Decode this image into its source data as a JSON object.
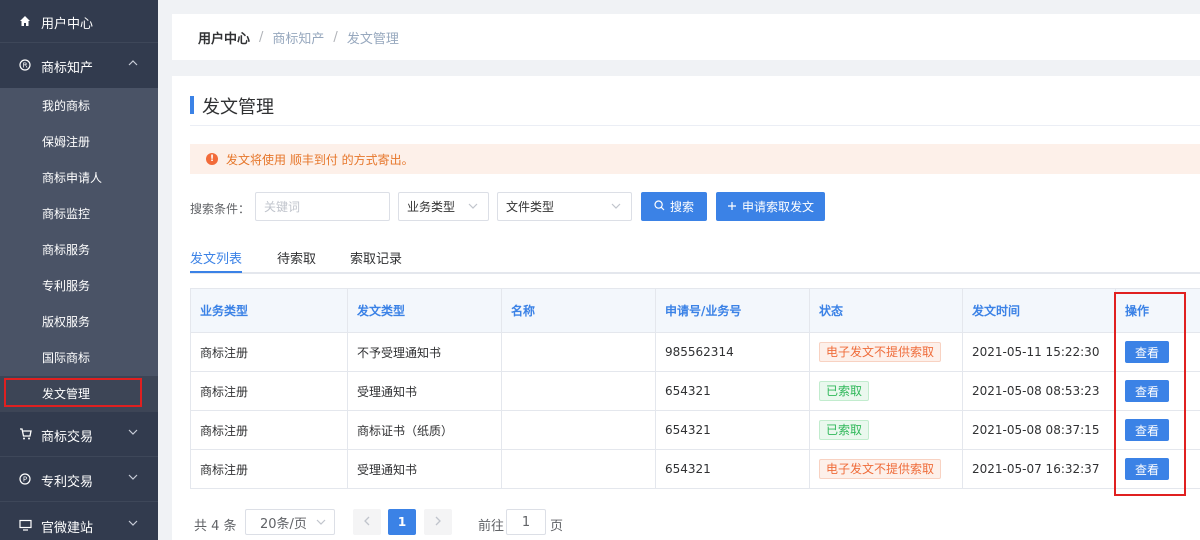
{
  "sidebar": {
    "top_items": [
      {
        "label": "用户中心",
        "icon": "home-icon"
      },
      {
        "label": "商标知产",
        "icon": "registered-icon"
      }
    ],
    "sub_items": [
      "我的商标",
      "保姆注册",
      "商标申请人",
      "商标监控",
      "商标服务",
      "专利服务",
      "版权服务",
      "国际商标",
      "发文管理"
    ],
    "bottom_items": [
      {
        "label": "商标交易",
        "icon": "cart-icon"
      },
      {
        "label": "专利交易",
        "icon": "patent-icon"
      },
      {
        "label": "官微建站",
        "icon": "monitor-icon"
      }
    ]
  },
  "breadcrumb": [
    "用户中心",
    "商标知产",
    "发文管理"
  ],
  "page_title": "发文管理",
  "notice": {
    "text": "发文将使用 顺丰到付 的方式寄出。"
  },
  "search": {
    "label": "搜索条件：",
    "keyword_placeholder": "关键词",
    "business_type": "业务类型",
    "file_type": "文件类型",
    "search_button": "搜索",
    "apply_button": "申请索取发文"
  },
  "tabs": [
    "发文列表",
    "待索取",
    "索取记录"
  ],
  "table": {
    "headers": [
      "业务类型",
      "发文类型",
      "名称",
      "申请号/业务号",
      "状态",
      "发文时间",
      "操作"
    ],
    "rows": [
      {
        "business": "商标注册",
        "doc_type": "不予受理通知书",
        "name": "",
        "number": "985562314",
        "status": "电子发文不提供索取",
        "status_kind": "warn",
        "time": "2021-05-11 15:22:30",
        "action": "查看"
      },
      {
        "business": "商标注册",
        "doc_type": "受理通知书",
        "name": "",
        "number": "654321",
        "status": "已索取",
        "status_kind": "ok",
        "time": "2021-05-08 08:53:23",
        "action": "查看"
      },
      {
        "business": "商标注册",
        "doc_type": "商标证书（纸质）",
        "name": "",
        "number": "654321",
        "status": "已索取",
        "status_kind": "ok",
        "time": "2021-05-08 08:37:15",
        "action": "查看"
      },
      {
        "business": "商标注册",
        "doc_type": "受理通知书",
        "name": "",
        "number": "654321",
        "status": "电子发文不提供索取",
        "status_kind": "warn",
        "time": "2021-05-07 16:32:37",
        "action": "查看"
      }
    ]
  },
  "pagination": {
    "total": "共 4 条",
    "page_size": "20条/页",
    "current_page": "1",
    "goto_label": "前往",
    "goto_value": "1",
    "page_label": "页"
  },
  "colors": {
    "primary": "#3b82e6",
    "sidebar": "#323b4e",
    "highlight": "#e02020"
  }
}
